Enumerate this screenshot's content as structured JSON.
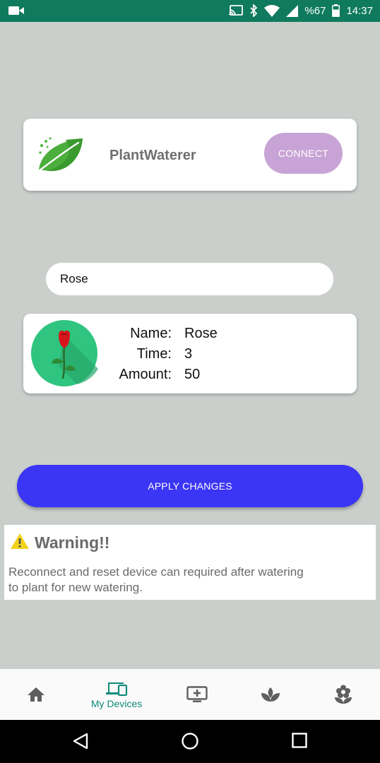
{
  "status_bar": {
    "battery_percent": "%67",
    "time": "14:37",
    "icons": [
      "video-camera-icon",
      "cast-icon",
      "bluetooth-icon",
      "wifi-icon",
      "signal-icon",
      "battery-icon"
    ]
  },
  "device_card": {
    "app_name": "PlantWaterer",
    "connect_label": "CONNECT",
    "logo_icon": "leaf-icon"
  },
  "plant_input": {
    "value": "Rose"
  },
  "plant_info": {
    "avatar_icon": "rose-icon",
    "name_label": "Name:",
    "time_label": "Time:",
    "amount_label": "Amount:",
    "name_value": "Rose",
    "time_value": "3",
    "amount_value": "50"
  },
  "apply_label": "APPLY CHANGES",
  "warning": {
    "title": "Warning!!",
    "text_line1": "Reconnect and reset device can required after watering",
    "text_line2": "to plant for new watering."
  },
  "bottom_nav": {
    "items": [
      {
        "icon": "home-icon",
        "label": ""
      },
      {
        "icon": "devices-icon",
        "label": "My Devices"
      },
      {
        "icon": "add-to-screen-icon",
        "label": ""
      },
      {
        "icon": "spa-icon",
        "label": ""
      },
      {
        "icon": "local-florist-icon",
        "label": ""
      }
    ],
    "active_color": "#0f8a7a"
  },
  "colors": {
    "status_bar": "#0f7a5d",
    "connect_button": "#c8a3d5",
    "apply_button": "#3b35f5",
    "background": "#cbcfcc"
  }
}
